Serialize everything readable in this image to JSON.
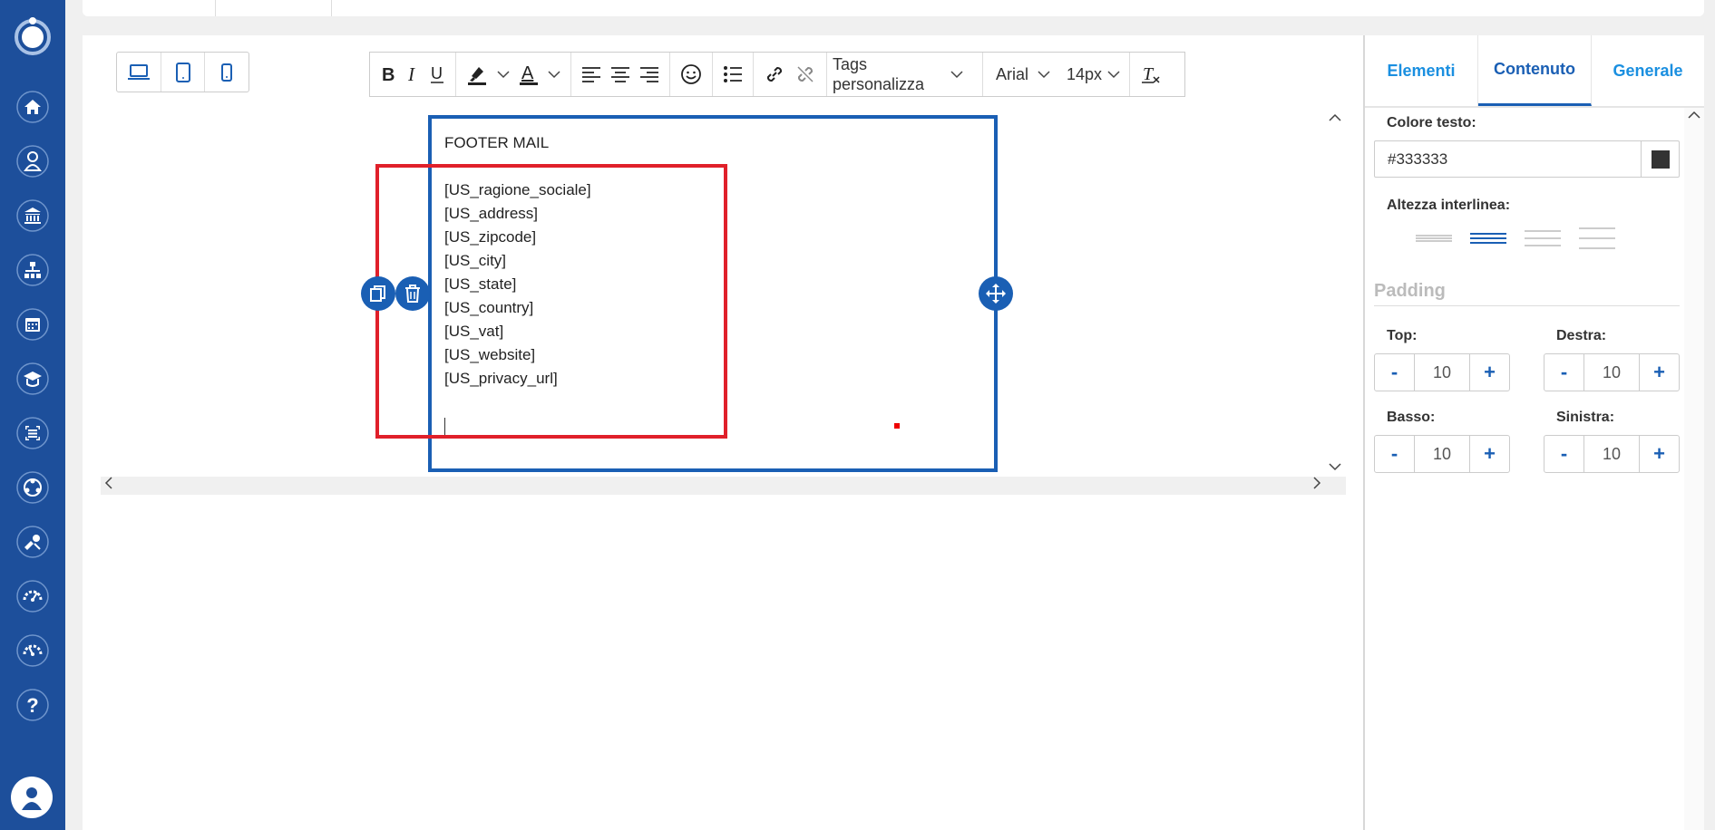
{
  "sidebar": {
    "items": [
      {
        "icon": "home-icon"
      },
      {
        "icon": "user-tie-icon"
      },
      {
        "icon": "bank-icon"
      },
      {
        "icon": "org-chart-icon"
      },
      {
        "icon": "calendar-icon"
      },
      {
        "icon": "graduation-icon"
      },
      {
        "icon": "list-scan-icon"
      },
      {
        "icon": "network-icon"
      },
      {
        "icon": "tools-icon"
      },
      {
        "icon": "gauge-icon"
      },
      {
        "icon": "gauge-alt-icon"
      },
      {
        "icon": "help-icon"
      }
    ]
  },
  "toolbar": {
    "tags_label": "Tags personalizza",
    "font_family": "Arial",
    "font_size": "14px"
  },
  "editor": {
    "lines": [
      "FOOTER MAIL",
      "",
      "[US_ragione_sociale]",
      "[US_address]",
      "[US_zipcode]",
      "[US_city]",
      "[US_state]",
      "[US_country]",
      "[US_vat]",
      "[US_website]",
      "[US_privacy_url]"
    ]
  },
  "right_panel": {
    "tabs": [
      "Elementi",
      "Contenuto",
      "Generale"
    ],
    "active_tab": "Contenuto",
    "text_color_label": "Colore testo:",
    "text_color_value": "#333333",
    "line_height_label": "Altezza interlinea:",
    "padding_title": "Padding",
    "padding": {
      "top_label": "Top:",
      "top_value": "10",
      "right_label": "Destra:",
      "right_value": "10",
      "bottom_label": "Basso:",
      "bottom_value": "10",
      "left_label": "Sinistra:",
      "left_value": "10"
    },
    "minus": "-",
    "plus": "+"
  },
  "colors": {
    "sidebar": "#1d4f9b",
    "accent": "#1a5fb4",
    "highlight": "#e0202a"
  }
}
